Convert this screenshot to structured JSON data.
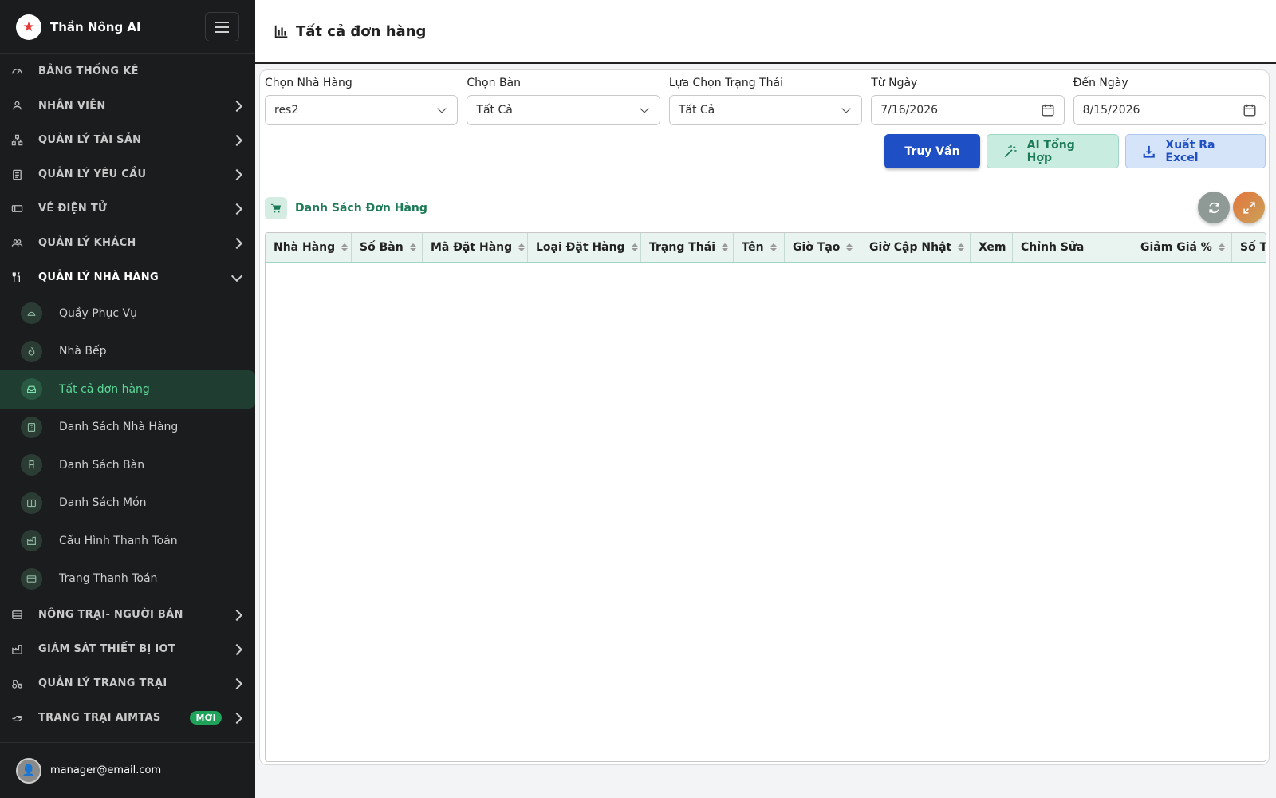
{
  "app": {
    "name": "Thần Nông AI"
  },
  "sidebar": {
    "items": [
      {
        "label": "BẢNG THỐNG KÊ",
        "icon": "dashboard-icon",
        "chevron": false
      },
      {
        "label": "NHÂN VIÊN",
        "icon": "people-icon",
        "chevron": true
      },
      {
        "label": "QUẢN LÝ TÀI SẢN",
        "icon": "hierarchy-icon",
        "chevron": true
      },
      {
        "label": "QUẢN LÝ YÊU CẦU",
        "icon": "clipboard-icon",
        "chevron": true
      },
      {
        "label": "VÉ ĐIỆN TỬ",
        "icon": "ticket-icon",
        "chevron": true
      },
      {
        "label": "QUẢN LÝ KHÁCH",
        "icon": "users-icon",
        "chevron": true
      },
      {
        "label": "QUẢN LÝ NHÀ HÀNG",
        "icon": "fork-knife-icon",
        "chevron": true,
        "open": true
      }
    ],
    "subitems": [
      {
        "label": "Quầy Phục Vụ",
        "icon": "cloche-icon"
      },
      {
        "label": "Nhà Bếp",
        "icon": "fire-icon"
      },
      {
        "label": "Tất cả đơn hàng",
        "icon": "tray-icon",
        "active": true
      },
      {
        "label": "Danh Sách Nhà Hàng",
        "icon": "calculator-icon"
      },
      {
        "label": "Danh Sách Bàn",
        "icon": "chair-icon"
      },
      {
        "label": "Danh Sách Món",
        "icon": "menu-book-icon"
      },
      {
        "label": "Cấu Hình Thanh Toán",
        "icon": "factory-icon"
      },
      {
        "label": "Trang Thanh Toán",
        "icon": "card-icon"
      }
    ],
    "bottom_items": [
      {
        "label": "NÔNG TRẠI- NGƯỜI BÁN",
        "icon": "store-icon"
      },
      {
        "label": "GIÁM SÁT THIẾT BỊ IOT",
        "icon": "factory-icon"
      },
      {
        "label": "QUẢN LÝ TRANG TRẠI",
        "icon": "tractor-icon"
      },
      {
        "label": "TRANG TRẠI AIMTAS",
        "icon": "hand-icon",
        "badge": "MỚI"
      }
    ],
    "user_email": "manager@email.com"
  },
  "header": {
    "title": "Tất cả đơn hàng"
  },
  "filters": {
    "restaurant": {
      "label": "Chọn Nhà Hàng",
      "value": "res2"
    },
    "table": {
      "label": "Chọn Bàn",
      "value": "Tất Cả"
    },
    "status": {
      "label": "Lựa Chọn Trạng Thái",
      "value": "Tất Cả"
    },
    "from_date": {
      "label": "Từ Ngày",
      "value": "7/16/2026"
    },
    "to_date": {
      "label": "Đến Ngày",
      "value": "8/15/2026"
    }
  },
  "actions": {
    "query": "Truy Vấn",
    "ai_summary": "AI Tổng Hợp",
    "export_excel": "Xuất Ra Excel"
  },
  "list": {
    "title": "Danh Sách Đơn Hàng",
    "columns": [
      {
        "label": "Nhà Hàng",
        "sortable": true
      },
      {
        "label": "Số Bàn",
        "sortable": true
      },
      {
        "label": "Mã Đặt Hàng",
        "sortable": true
      },
      {
        "label": "Loại Đặt Hàng",
        "sortable": true
      },
      {
        "label": "Trạng Thái",
        "sortable": true
      },
      {
        "label": "Tên",
        "sortable": true
      },
      {
        "label": "Giờ Tạo",
        "sortable": true
      },
      {
        "label": "Giờ Cập Nhật",
        "sortable": true
      },
      {
        "label": "Xem",
        "sortable": false
      },
      {
        "label": "Chỉnh Sửa",
        "sortable": false
      },
      {
        "label": "Giảm Giá %",
        "sortable": true
      },
      {
        "label": "Số T",
        "sortable": false
      }
    ],
    "rows": []
  },
  "colors": {
    "sidebar_bg": "#1b1c1e",
    "active_green": "#5fd79a",
    "primary_blue": "#1e4fc4",
    "teal": "#1d7a56"
  }
}
